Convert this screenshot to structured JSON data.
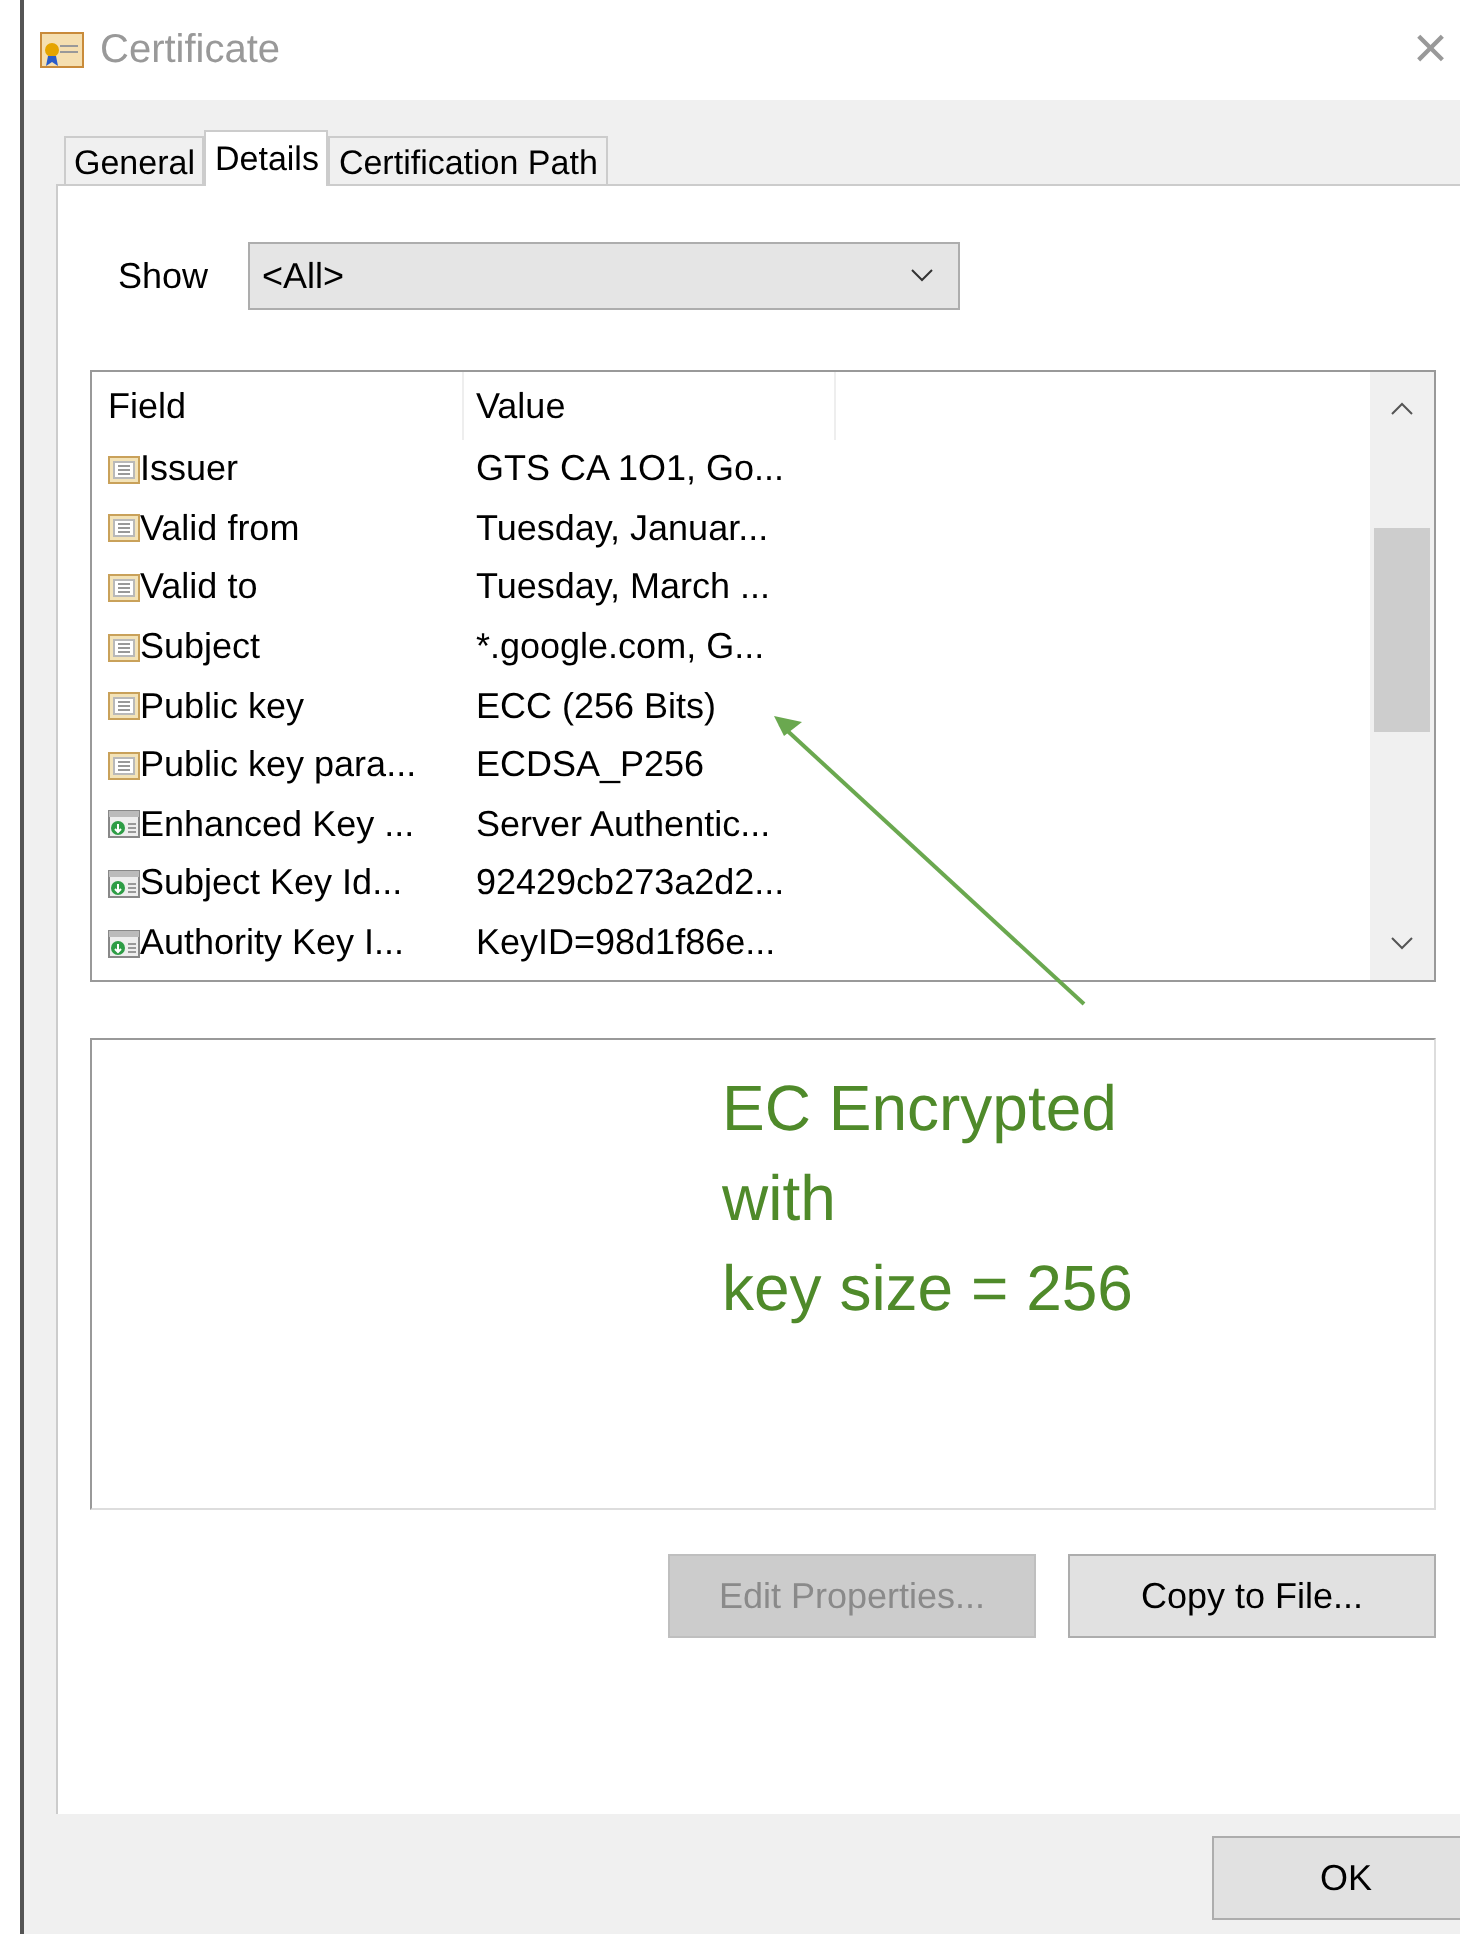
{
  "window": {
    "title": "Certificate",
    "close": "×"
  },
  "tabs": [
    {
      "label": "General",
      "selected": false
    },
    {
      "label": "Details",
      "selected": true
    },
    {
      "label": "Certification Path",
      "selected": false
    }
  ],
  "show": {
    "label": "Show",
    "value": "<All>"
  },
  "table": {
    "columns": [
      "Field",
      "Value"
    ],
    "rows": [
      {
        "kind": "text",
        "field": "Issuer",
        "value": "GTS CA 1O1, Go..."
      },
      {
        "kind": "text",
        "field": "Valid from",
        "value": "Tuesday, Januar..."
      },
      {
        "kind": "text",
        "field": "Valid to",
        "value": "Tuesday, March ..."
      },
      {
        "kind": "text",
        "field": "Subject",
        "value": "*.google.com, G..."
      },
      {
        "kind": "text",
        "field": "Public key",
        "value": "ECC (256 Bits)"
      },
      {
        "kind": "text",
        "field": "Public key para...",
        "value": "ECDSA_P256"
      },
      {
        "kind": "extension",
        "field": "Enhanced Key ...",
        "value": "Server Authentic..."
      },
      {
        "kind": "extension",
        "field": "Subject Key Id...",
        "value": "92429cb273a2d2..."
      },
      {
        "kind": "extension",
        "field": "Authority Key I...",
        "value": "KeyID=98d1f86e..."
      }
    ]
  },
  "annotation": {
    "lines": [
      "EC Encrypted",
      "with",
      "key size = 256"
    ]
  },
  "buttons": [
    {
      "label": "Edit Properties...",
      "disabled": true
    },
    {
      "label": "Copy to File...",
      "disabled": false
    }
  ],
  "ok": "OK"
}
